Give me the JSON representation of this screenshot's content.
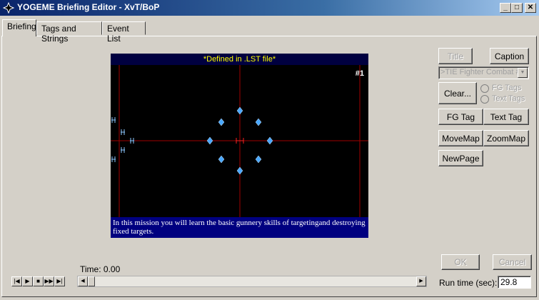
{
  "window": {
    "title": "YOGEME Briefing Editor - XvT/BoP",
    "minimize_label": "_",
    "maximize_label": "□",
    "close_label": "✕"
  },
  "tabs": [
    {
      "label": "Briefing"
    },
    {
      "label": "Tags and Strings"
    },
    {
      "label": "Event List"
    }
  ],
  "map": {
    "header": "*Defined in .LST file*",
    "page_number": "#1",
    "caption": "In this mission you will learn the basic gunnery skills of targetingand destroying fixed targets.",
    "background_color": "#000000",
    "grid_color": "#a00000",
    "marker_color": "#4aa8ff"
  },
  "right_panel": {
    "title_button": "Title",
    "caption_button": "Caption",
    "fg_select_value": ">TIE Fighter Combat #",
    "clear_button": "Clear...",
    "radio_fg_tags": "FG Tags",
    "radio_text_tags": "Text Tags",
    "fg_tag_button": "FG Tag",
    "text_tag_button": "Text Tag",
    "movemap_button": "MoveMap",
    "zoommap_button": "ZoomMap",
    "newpage_button": "NewPage"
  },
  "bottom": {
    "time_label": "Time: 0.00",
    "ok_button": "OK",
    "cancel_button": "Cancel",
    "run_time_label": "Run time (sec):",
    "run_time_value": "29.8"
  },
  "playback": {
    "buttons": [
      "|◀",
      "▶",
      "■",
      "▶▶",
      "▶|"
    ]
  }
}
